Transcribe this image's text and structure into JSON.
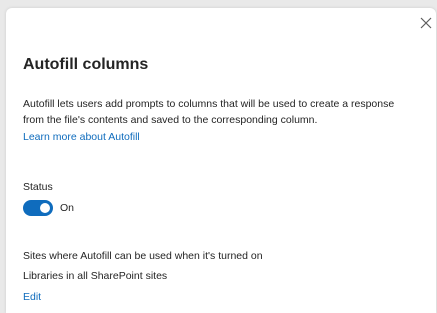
{
  "dialog": {
    "title": "Autofill columns",
    "description": "Autofill lets users add prompts to columns that will be used to create a response from the file's contents and saved to the corresponding column.",
    "learn_more_link": "Learn more about Autofill",
    "close_icon": "close-icon"
  },
  "status": {
    "label": "Status",
    "toggle_state": "On",
    "toggle_on": true,
    "accent_color": "#0f6cbd"
  },
  "sites": {
    "label": "Sites where Autofill can be used when it's turned on",
    "value": "Libraries in all SharePoint sites",
    "edit_link": "Edit"
  }
}
